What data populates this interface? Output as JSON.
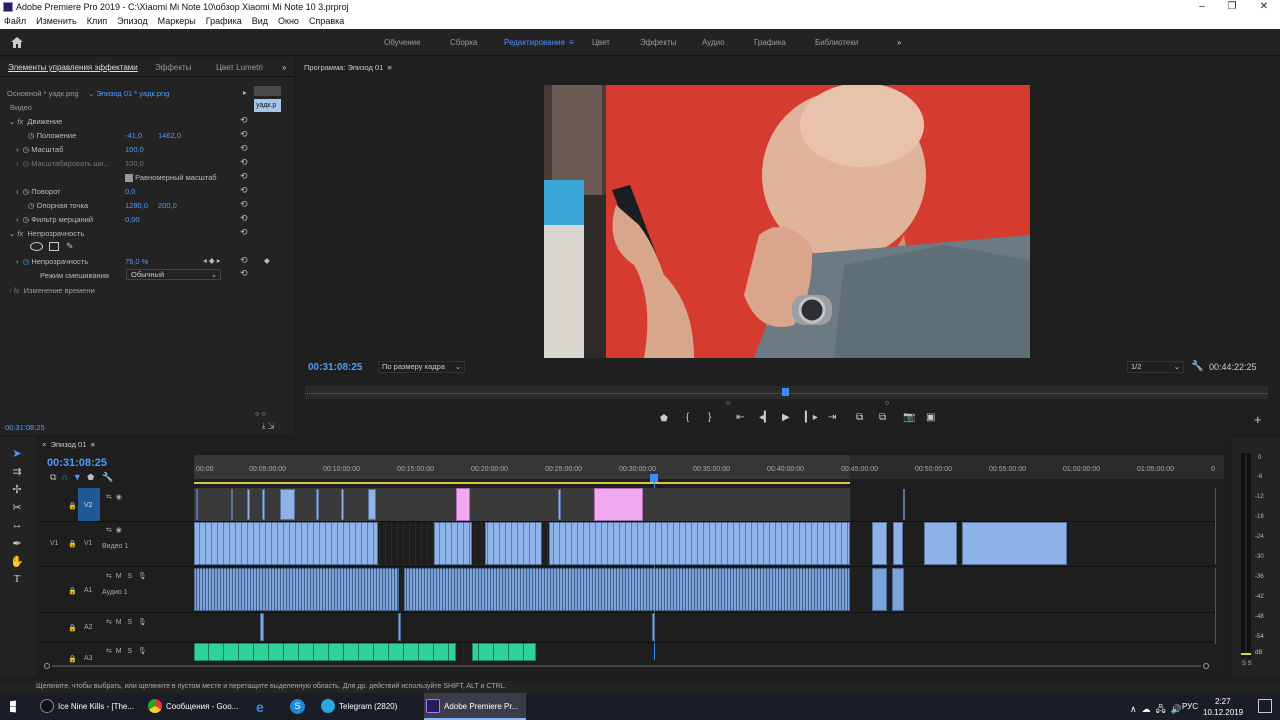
{
  "titlebar": {
    "title": "Adobe Premiere Pro 2019 - C:\\Xiaomi Mi Note 10\\обзор Xiaomi Mi Note 10 3.prproj"
  },
  "menu": [
    "Файл",
    "Изменить",
    "Клип",
    "Эпизод",
    "Маркеры",
    "Графика",
    "Вид",
    "Окно",
    "Справка"
  ],
  "workspaces": {
    "items": [
      "Обучение",
      "Сборка",
      "Редактирование",
      "Цвет",
      "Эффекты",
      "Аудио",
      "Графика",
      "Библиотеки"
    ],
    "active": "Редактирование"
  },
  "effects_panel": {
    "tabs": [
      "Элементы управления эффектами",
      "Эффекты",
      "Цвет Lumetri"
    ],
    "source": "Основной * уадк.png",
    "sequence": "Эпизод 01 * уадк.png",
    "clip_name": "уадк.p",
    "section_video": "Видео",
    "motion": "Движение",
    "position_label": "Положение",
    "position_x": "-41,0",
    "position_y": "1462,0",
    "scale_label": "Масштаб",
    "scale_value": "100,0",
    "scale_width_label": "Масштабировать ши...",
    "scale_width_value": "100,0",
    "uniform_scale": "Равномерный масштаб",
    "rotation_label": "Поворот",
    "rotation_value": "0,0",
    "anchor_label": "Опорная точка",
    "anchor_x": "1280,0",
    "anchor_y": "200,0",
    "flicker_label": "Фильтр мерцаний",
    "flicker_value": "0,00",
    "opacity_section": "Непрозрачность",
    "opacity_label": "Непрозрачность",
    "opacity_value": "75,0 %",
    "blend_label": "Режим смешивания",
    "blend_value": "Обычный",
    "time_remap": "Изменение времени",
    "timecode": "00:31:08:25"
  },
  "program": {
    "title": "Программа: Эпизод 01",
    "timecode": "00:31:08:25",
    "fit": "По размеру кадра",
    "resolution": "1/2",
    "duration": "00:44:22:25"
  },
  "timeline": {
    "tab": "Эпизод 01",
    "timecode": "00:31:08:25",
    "ruler": [
      "00:00",
      "00:05:00:00",
      "00:10:00:00",
      "00:15:00:00",
      "00:20:00:00",
      "00:25:00:00",
      "00:30:00:00",
      "00:35:00:00",
      "00:40:00:00",
      "00:45:00:00",
      "00:50:00:00",
      "00:55:00:00",
      "01:00:00:00",
      "01:05:00:00",
      "0"
    ],
    "tracks": {
      "v2": "V2",
      "v1": "V1",
      "v1name": "Видео 1",
      "a1": "A1",
      "a1name": "Аудио 1",
      "a2": "A2",
      "a3": "A3"
    }
  },
  "meter_labels": [
    "0",
    "-6",
    "-12",
    "-18",
    "-24",
    "-30",
    "-36",
    "-42",
    "-48",
    "-54",
    "dB"
  ],
  "meter_solo": "S  S",
  "status": "Щелкните, чтобы выбрать, или щелкните в пустом месте и перетащите выделенную область. Для др. действий используйте SHIFT, ALT и CTRL.",
  "taskbar": {
    "items": [
      "Ice Nine Kills - [The...",
      "Сообщения - Goo...",
      "Telegram (2820)",
      "Adobe Premiere Pr..."
    ],
    "lang": "РУС",
    "time": "2:27",
    "date": "10.12.2019"
  },
  "colors": {
    "accent": "#4a90ff",
    "audio_clip": "#7ba4dc",
    "graphic_clip": "#2fd39a",
    "pink_clip": "#f0a8ef"
  }
}
